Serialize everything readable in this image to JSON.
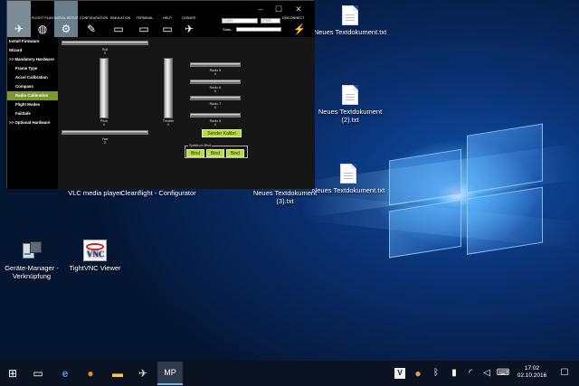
{
  "app": {
    "tabs": [
      {
        "label": "",
        "icon": "wizard-icon"
      },
      {
        "label": "FLIGHT PLAN",
        "icon": "globe-icon"
      },
      {
        "label": "INITIAL SETUP",
        "icon": "gear-icon"
      },
      {
        "label": "CONFIGURATION",
        "icon": "wrench-icon"
      },
      {
        "label": "SIMULATION",
        "icon": "monitor-icon"
      },
      {
        "label": "TERMINAL",
        "icon": "terminal-icon"
      },
      {
        "label": "HELP",
        "icon": "help-icon"
      },
      {
        "label": "DONATE",
        "icon": "donate-icon"
      }
    ],
    "com_value": "COM3",
    "baud_value": "57600",
    "stats_label": "Stats...",
    "disconnect_label": "DISCONNECT",
    "sidebar": [
      {
        "label": "Install Firmware",
        "sub": false,
        "active": false
      },
      {
        "label": "Wizard",
        "sub": false,
        "active": false
      },
      {
        "label": ">> Mandatory Hardware",
        "sub": false,
        "active": false
      },
      {
        "label": "Frame Type",
        "sub": true,
        "active": false
      },
      {
        "label": "Accel Calibration",
        "sub": true,
        "active": false
      },
      {
        "label": "Compass",
        "sub": true,
        "active": false
      },
      {
        "label": "Radio Calibration",
        "sub": true,
        "active": true
      },
      {
        "label": "Flight Modes",
        "sub": true,
        "active": false
      },
      {
        "label": "FailSafe",
        "sub": true,
        "active": false
      },
      {
        "label": ">> Optional Hardware",
        "sub": false,
        "active": false
      }
    ],
    "radio": {
      "roll": {
        "label": "Roll",
        "value": "0"
      },
      "pitch": {
        "label": "Pitch",
        "value": "0"
      },
      "throttle": {
        "label": "Throttle",
        "value": "0"
      },
      "yaw": {
        "label": "Yaw",
        "value": "0"
      },
      "radio5": {
        "label": "Radio 5",
        "value": "0"
      },
      "radio6": {
        "label": "Radio 6",
        "value": "0"
      },
      "radio7": {
        "label": "Radio 7",
        "value": "0"
      },
      "radio8": {
        "label": "Radio 8",
        "value": "0"
      },
      "calibrate_label": "Sender Kalibri",
      "spektrum_label": "Spektrum Bind",
      "bind_labels": [
        "Bind",
        "Bind",
        "Bind"
      ]
    }
  },
  "desktop": [
    {
      "label": "Neues Textdokument.txt",
      "icon": "text-file-icon"
    },
    {
      "label": "Neues Textdokument (2).txt",
      "icon": "text-file-icon"
    },
    {
      "label": "Neues Textdokument.txt",
      "icon": "text-file-icon"
    },
    {
      "label": "Neues Textdokument (3).txt",
      "icon": "text-file-icon"
    },
    {
      "label": "VLC media player",
      "icon": "vlc-icon"
    },
    {
      "label": "Cleanflight - Configurator",
      "icon": "cleanflight-icon"
    },
    {
      "label": "Geräte-Manager - Verknüpfung",
      "icon": "device-manager-icon"
    },
    {
      "label": "TightVNC Viewer",
      "icon": "tightvnc-icon"
    }
  ],
  "taskbar": {
    "time": "17:02",
    "date": "02.10.2016"
  }
}
